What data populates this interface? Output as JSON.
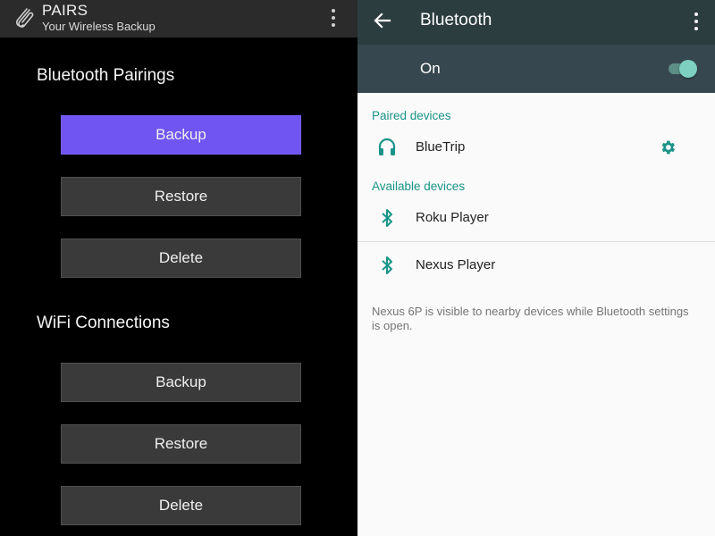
{
  "left_app": {
    "title": "PAIRS",
    "subtitle": "Your Wireless Backup",
    "logo_icon": "paperclip-icon",
    "overflow_icon": "more-vert-icon",
    "sections": [
      {
        "title": "Bluetooth Pairings",
        "buttons": [
          {
            "label": "Backup",
            "primary": true
          },
          {
            "label": "Restore",
            "primary": false
          },
          {
            "label": "Delete",
            "primary": false
          }
        ]
      },
      {
        "title": "WiFi Connections",
        "buttons": [
          {
            "label": "Backup",
            "primary": false
          },
          {
            "label": "Restore",
            "primary": false
          },
          {
            "label": "Delete",
            "primary": false
          }
        ]
      }
    ],
    "colors": {
      "background": "#000000",
      "appbar": "#2b2b2b",
      "accent": "#7155f2",
      "button": "#3a3a3a"
    }
  },
  "settings": {
    "title": "Bluetooth",
    "back_icon": "arrow-back-icon",
    "overflow_icon": "more-vert-icon",
    "master_switch": {
      "label": "On",
      "checked": true
    },
    "paired_header": "Paired devices",
    "paired_devices": [
      {
        "name": "BlueTrip",
        "icon": "headset-icon",
        "settings_icon": "gear-icon"
      }
    ],
    "available_header": "Available devices",
    "available_devices": [
      {
        "name": "Roku Player",
        "icon": "bluetooth-icon"
      },
      {
        "name": "Nexus Player",
        "icon": "bluetooth-icon"
      }
    ],
    "visibility_note": "Nexus 6P is visible to nearby devices while Bluetooth settings is open.",
    "colors": {
      "toolbar": "#2c3d40",
      "master_bar": "#37474f",
      "accent": "#1a9488",
      "background": "#fafafa"
    }
  }
}
